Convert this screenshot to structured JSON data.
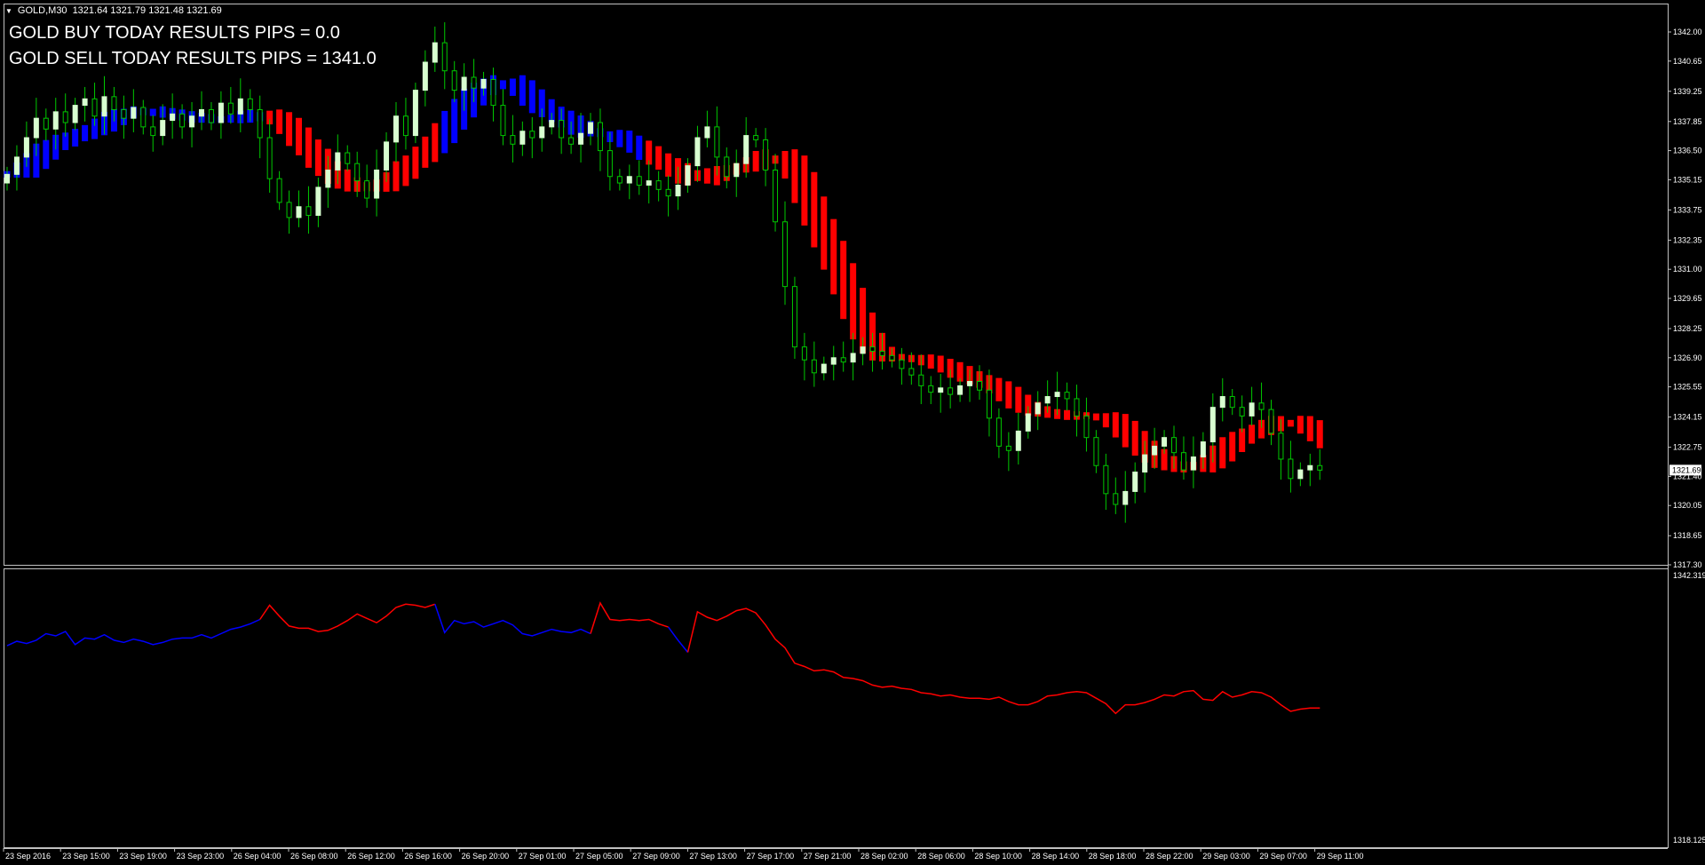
{
  "header": {
    "symbol": "GOLD,M30",
    "ohlc": "1321.64 1321.79 1321.48 1321.69"
  },
  "overlay": {
    "buy_text": "GOLD BUY TODAY RESULTS PIPS = 0.0",
    "sell_text": "GOLD SELL TODAY RESULTS PIPS = 1341.0"
  },
  "colors": {
    "background": "#000000",
    "grid": "#c0c0c0",
    "bull_candle": "#d8ffd0",
    "bear_candle": "#00c800",
    "up_trend": "#0000ff",
    "down_trend": "#ff0000",
    "text": "#ffffff"
  },
  "chart_data": [
    {
      "type": "candlestick",
      "title": "GOLD,M30",
      "price_axis_labels": [
        "1342.00",
        "1340.65",
        "1339.25",
        "1337.85",
        "1336.50",
        "1335.15",
        "1333.75",
        "1332.35",
        "1331.00",
        "1329.65",
        "1328.25",
        "1326.90",
        "1325.55",
        "1324.15",
        "1322.75",
        "1321.40",
        "1320.05",
        "1318.65",
        "1317.30"
      ],
      "ylim": [
        1317.3,
        1342.0
      ],
      "current_price": "1321.69",
      "time_labels": [
        "23 Sep 2016",
        "23 Sep 15:00",
        "23 Sep 19:00",
        "23 Sep 23:00",
        "26 Sep 04:00",
        "26 Sep 08:00",
        "26 Sep 12:00",
        "26 Sep 16:00",
        "26 Sep 20:00",
        "27 Sep 01:00",
        "27 Sep 05:00",
        "27 Sep 09:00",
        "27 Sep 13:00",
        "27 Sep 17:00",
        "27 Sep 21:00",
        "28 Sep 02:00",
        "28 Sep 06:00",
        "28 Sep 10:00",
        "28 Sep 14:00",
        "28 Sep 18:00",
        "28 Sep 22:00",
        "29 Sep 03:00",
        "29 Sep 07:00",
        "29 Sep 11:00"
      ],
      "close": [
        1335.4,
        1336.2,
        1337.1,
        1338.0,
        1337.5,
        1338.3,
        1337.8,
        1338.6,
        1338.9,
        1338.1,
        1339.0,
        1338.4,
        1338.0,
        1338.5,
        1337.6,
        1337.2,
        1337.9,
        1338.2,
        1337.6,
        1338.1,
        1338.4,
        1337.8,
        1338.7,
        1338.2,
        1338.9,
        1338.4,
        1337.1,
        1335.2,
        1334.1,
        1333.4,
        1333.9,
        1333.5,
        1334.8,
        1335.6,
        1336.4,
        1335.9,
        1335.1,
        1334.3,
        1335.6,
        1336.9,
        1338.1,
        1337.2,
        1339.3,
        1340.6,
        1341.5,
        1340.2,
        1339.3,
        1339.9,
        1339.4,
        1339.8,
        1338.6,
        1337.2,
        1336.8,
        1337.4,
        1337.1,
        1337.6,
        1337.9,
        1337.1,
        1336.8,
        1337.3,
        1337.8,
        1336.5,
        1335.3,
        1335.0,
        1335.3,
        1334.9,
        1335.1,
        1334.7,
        1334.4,
        1334.9,
        1335.8,
        1337.1,
        1337.6,
        1336.2,
        1335.3,
        1335.9,
        1337.2,
        1337.0,
        1335.6,
        1333.2,
        1330.2,
        1327.4,
        1326.8,
        1326.2,
        1326.6,
        1326.9,
        1326.7,
        1327.1,
        1327.4,
        1327.2,
        1327.0,
        1326.8,
        1326.4,
        1326.1,
        1325.6,
        1325.3,
        1325.5,
        1325.2,
        1325.6,
        1325.8,
        1325.4,
        1324.1,
        1322.8,
        1322.6,
        1323.5,
        1324.3,
        1324.8,
        1325.1,
        1325.3,
        1325.0,
        1324.2,
        1323.2,
        1321.9,
        1320.6,
        1320.1,
        1320.7,
        1321.6,
        1322.4,
        1322.8,
        1323.2,
        1322.5,
        1321.7,
        1322.3,
        1323.0,
        1324.6,
        1325.1,
        1324.6,
        1324.2,
        1324.8,
        1324.5,
        1323.4,
        1322.2,
        1321.3,
        1321.7,
        1321.9,
        1321.69
      ],
      "bands": [
        {
          "trend": "up",
          "from_index": 0,
          "to_index": 26
        },
        {
          "trend": "down",
          "from_index": 27,
          "to_index": 44
        },
        {
          "trend": "up",
          "from_index": 45,
          "to_index": 65
        },
        {
          "trend": "down",
          "from_index": 66,
          "to_index": 135
        }
      ]
    },
    {
      "type": "line",
      "title": "",
      "ylim": [
        1318.125,
        1342.319
      ],
      "axis_labels": [
        "1342.319",
        "1318.125"
      ],
      "values": [
        1335.9,
        1336.3,
        1336.1,
        1336.4,
        1337.0,
        1336.8,
        1337.2,
        1336.0,
        1336.6,
        1336.5,
        1336.9,
        1336.4,
        1336.2,
        1336.5,
        1336.3,
        1336.0,
        1336.2,
        1336.5,
        1336.6,
        1336.6,
        1336.9,
        1336.6,
        1337.0,
        1337.4,
        1337.6,
        1337.9,
        1338.3,
        1339.6,
        1338.6,
        1337.7,
        1337.5,
        1337.5,
        1337.2,
        1337.3,
        1337.7,
        1338.2,
        1338.8,
        1338.4,
        1338.0,
        1338.6,
        1339.4,
        1339.7,
        1339.6,
        1339.4,
        1339.7,
        1337.1,
        1338.2,
        1337.9,
        1338.1,
        1337.6,
        1337.9,
        1338.2,
        1337.8,
        1337.0,
        1336.8,
        1337.1,
        1337.4,
        1337.2,
        1337.1,
        1337.4,
        1337.0,
        1339.8,
        1338.3,
        1338.2,
        1338.3,
        1338.2,
        1338.3,
        1337.9,
        1337.6,
        1336.4,
        1335.3,
        1339.0,
        1338.5,
        1338.2,
        1338.6,
        1339.1,
        1339.3,
        1338.9,
        1337.8,
        1336.5,
        1335.7,
        1334.3,
        1334.0,
        1333.6,
        1333.7,
        1333.5,
        1333.0,
        1332.9,
        1332.7,
        1332.3,
        1332.1,
        1332.2,
        1332.0,
        1331.9,
        1331.6,
        1331.5,
        1331.3,
        1331.4,
        1331.2,
        1331.1,
        1331.1,
        1331.0,
        1331.2,
        1330.8,
        1330.5,
        1330.5,
        1330.8,
        1331.3,
        1331.4,
        1331.6,
        1331.7,
        1331.6,
        1331.1,
        1330.6,
        1329.7,
        1330.5,
        1330.5,
        1330.7,
        1331.0,
        1331.4,
        1331.3,
        1331.7,
        1331.8,
        1331.0,
        1330.9,
        1331.7,
        1331.2,
        1331.4,
        1331.7,
        1331.6,
        1331.2,
        1330.5,
        1329.9,
        1330.1,
        1330.2,
        1330.2
      ],
      "color_segments": [
        {
          "trend": "up",
          "from_index": 0,
          "to_index": 26
        },
        {
          "trend": "down",
          "from_index": 26,
          "to_index": 44
        },
        {
          "trend": "up",
          "from_index": 44,
          "to_index": 60
        },
        {
          "trend": "down",
          "from_index": 60,
          "to_index": 68
        },
        {
          "trend": "up",
          "from_index": 68,
          "to_index": 70
        },
        {
          "trend": "down",
          "from_index": 70,
          "to_index": 135
        }
      ]
    }
  ]
}
